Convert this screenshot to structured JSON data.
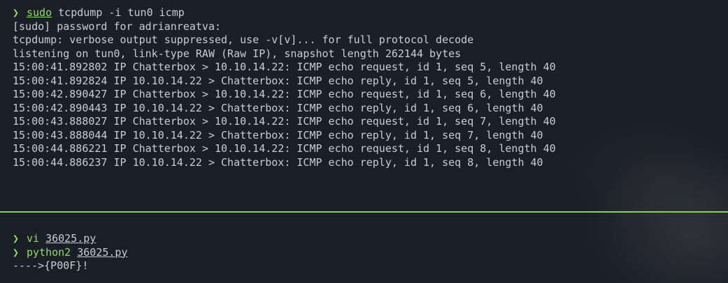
{
  "top_pane": {
    "prompt_symbol": "❯",
    "command": "sudo",
    "args": " tcpdump -i tun0 icmp",
    "output": [
      "[sudo] password for adrianreatva:",
      "tcpdump: verbose output suppressed, use -v[v]... for full protocol decode",
      "listening on tun0, link-type RAW (Raw IP), snapshot length 262144 bytes",
      "15:00:41.892802 IP Chatterbox > 10.10.14.22: ICMP echo request, id 1, seq 5, length 40",
      "15:00:41.892824 IP 10.10.14.22 > Chatterbox: ICMP echo reply, id 1, seq 5, length 40",
      "15:00:42.890427 IP Chatterbox > 10.10.14.22: ICMP echo request, id 1, seq 6, length 40",
      "15:00:42.890443 IP 10.10.14.22 > Chatterbox: ICMP echo reply, id 1, seq 6, length 40",
      "15:00:43.888027 IP Chatterbox > 10.10.14.22: ICMP echo request, id 1, seq 7, length 40",
      "15:00:43.888044 IP 10.10.14.22 > Chatterbox: ICMP echo reply, id 1, seq 7, length 40",
      "15:00:44.886221 IP Chatterbox > 10.10.14.22: ICMP echo request, id 1, seq 8, length 40",
      "15:00:44.886237 IP 10.10.14.22 > Chatterbox: ICMP echo reply, id 1, seq 8, length 40"
    ]
  },
  "bottom_pane": {
    "commands": [
      {
        "prompt_symbol": "❯",
        "command": "vi",
        "arg": "36025.py"
      },
      {
        "prompt_symbol": "❯",
        "command": "python2",
        "arg": "36025.py"
      }
    ],
    "output": "---->{P00F}!"
  },
  "colors": {
    "background": "#1b1f27",
    "prompt": "#8fdd63",
    "text": "#c7ccd6",
    "divider": "#7fd64d"
  }
}
